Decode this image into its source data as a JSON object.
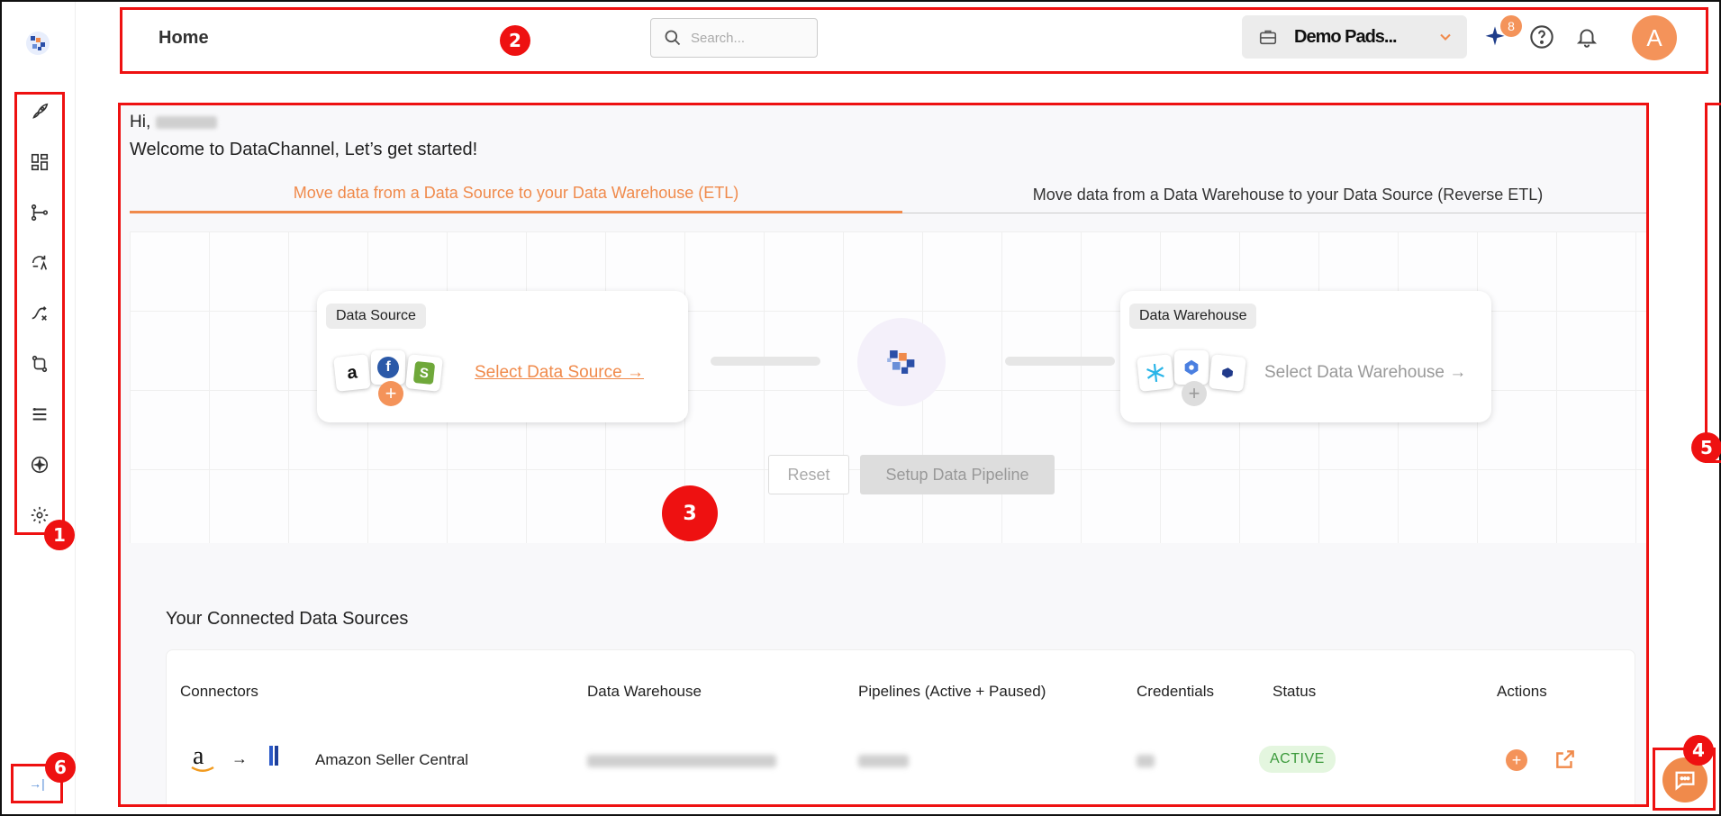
{
  "sidebar": {
    "items": [
      {
        "icon": "rocket-icon"
      },
      {
        "icon": "dashboard-icon"
      },
      {
        "icon": "pipeline-icon"
      },
      {
        "icon": "reverse-etl-icon"
      },
      {
        "icon": "transform-icon"
      },
      {
        "icon": "sync-icon"
      },
      {
        "icon": "layers-icon"
      },
      {
        "icon": "sparkle-icon"
      },
      {
        "icon": "gear-icon"
      }
    ],
    "collapse_label": "→|"
  },
  "annotations": [
    "1",
    "2",
    "3",
    "4",
    "5",
    "6"
  ],
  "header": {
    "title": "Home",
    "search_placeholder": "Search...",
    "workspace_name": "Demo Pads...",
    "notification_count": "8",
    "avatar_letter": "A"
  },
  "main": {
    "greeting_prefix": "Hi,",
    "welcome": "Welcome to DataChannel, Let’s get started!",
    "tabs": [
      {
        "label": "Move data from a Data Source to your Data Warehouse (ETL)",
        "active": true
      },
      {
        "label": "Move data from a Data Warehouse to your Data Source (Reverse ETL)",
        "active": false
      }
    ],
    "source_card": {
      "pill": "Data Source",
      "link": "Select Data Source →",
      "logos": [
        "a",
        "f",
        "S"
      ]
    },
    "warehouse_card": {
      "pill": "Data Warehouse",
      "link": "Select Data Warehouse →"
    },
    "buttons": {
      "reset": "Reset",
      "setup": "Setup Data Pipeline"
    },
    "connected": {
      "title": "Your Connected Data Sources",
      "columns": [
        "Connectors",
        "Data Warehouse",
        "Pipelines (Active + Paused)",
        "Credentials",
        "Status",
        "Actions"
      ],
      "rows": [
        {
          "connector": "Amazon Seller Central",
          "status": "ACTIVE"
        }
      ]
    }
  },
  "colors": {
    "accent": "#f08a4b",
    "annotation": "#e11111",
    "active_status_bg": "#e4f6df",
    "active_status_text": "#3c9a3c"
  }
}
